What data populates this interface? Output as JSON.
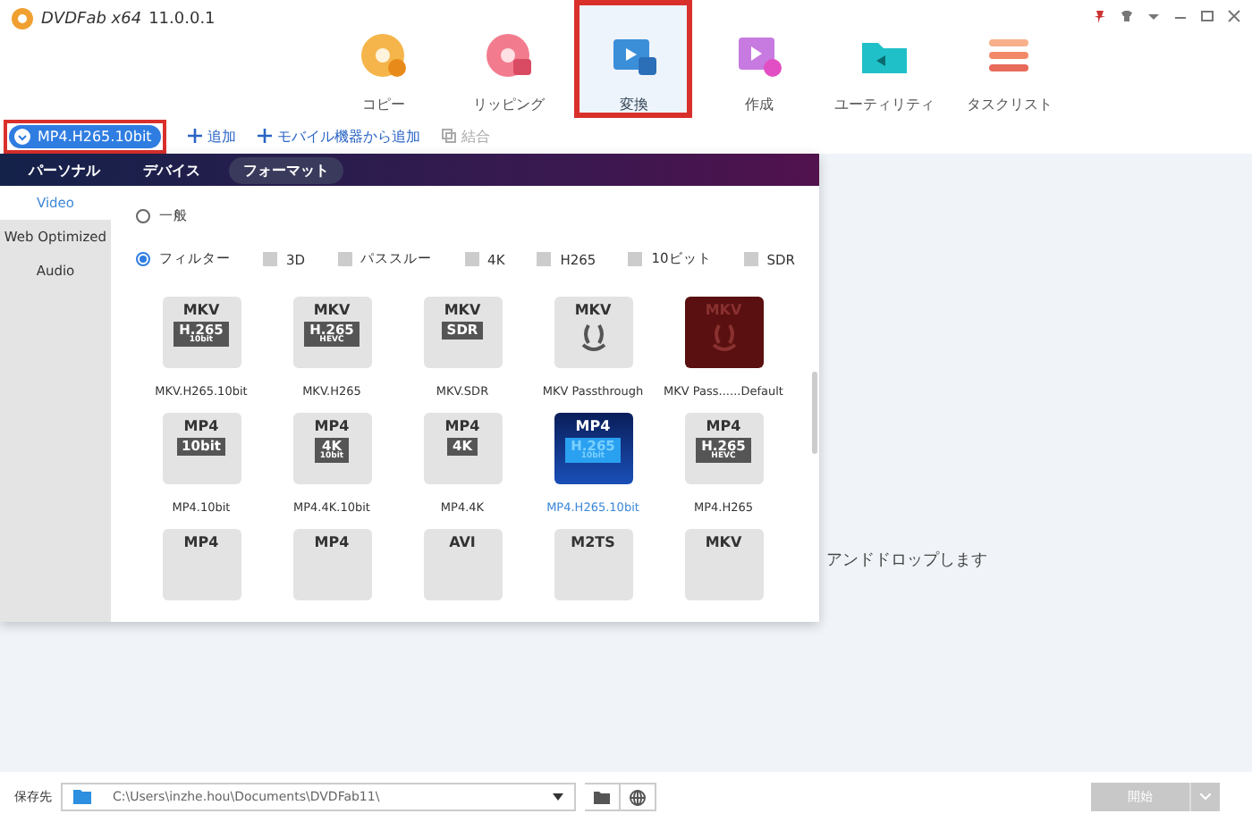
{
  "window": {
    "app_name": "DVDFab x64",
    "version": "11.0.0.1"
  },
  "nav": [
    {
      "label": "コピー",
      "kind": "copy",
      "selected": false
    },
    {
      "label": "リッピング",
      "kind": "ripping",
      "selected": false
    },
    {
      "label": "変換",
      "kind": "convert",
      "selected": true
    },
    {
      "label": "作成",
      "kind": "creator",
      "selected": false
    },
    {
      "label": "ユーティリティ",
      "kind": "utility",
      "selected": false
    },
    {
      "label": "タスクリスト",
      "kind": "tasks",
      "selected": false
    }
  ],
  "toolbar": {
    "profile": "MP4.H265.10bit",
    "add": "追加",
    "add_mobile": "モバイル機器から追加",
    "merge": {
      "label": "結合",
      "disabled": true
    }
  },
  "panel": {
    "tabs": [
      {
        "label": "パーソナル",
        "selected": false
      },
      {
        "label": "デバイス",
        "selected": false
      },
      {
        "label": "フォーマット",
        "selected": true
      }
    ],
    "categories": [
      {
        "label": "Video",
        "selected": true
      },
      {
        "label": "Web Optimized",
        "selected": false
      },
      {
        "label": "Audio",
        "selected": false
      }
    ],
    "modes": [
      {
        "label": "一般",
        "selected": false
      },
      {
        "label": "フィルター",
        "selected": true
      }
    ],
    "filters": [
      {
        "label": "3D",
        "checked": false
      },
      {
        "label": "パススルー",
        "checked": false
      },
      {
        "label": "4K",
        "checked": false
      },
      {
        "label": "H265",
        "checked": false
      },
      {
        "label": "10ビット",
        "checked": false
      },
      {
        "label": "SDR",
        "checked": false
      }
    ],
    "profiles": [
      {
        "format": "MKV",
        "kind": "badge",
        "badge": [
          "H.265",
          "10bit"
        ],
        "label": "MKV.H265.10bit",
        "selected": false
      },
      {
        "format": "MKV",
        "kind": "badge",
        "badge": [
          "H.265",
          "HEVC"
        ],
        "label": "MKV.H265",
        "selected": false
      },
      {
        "format": "MKV",
        "kind": "badge",
        "badge": [
          "SDR"
        ],
        "label": "MKV.SDR",
        "selected": false
      },
      {
        "format": "MKV",
        "kind": "passthrough",
        "label": "MKV Passthrough",
        "selected": false
      },
      {
        "format": "MKV",
        "kind": "passthrough-default",
        "label": "MKV Pass......Default",
        "selected": false
      },
      {
        "format": "MP4",
        "kind": "badge",
        "badge": [
          "10bit"
        ],
        "label": "MP4.10bit",
        "selected": false
      },
      {
        "format": "MP4",
        "kind": "badge",
        "badge": [
          "4K",
          "10bit"
        ],
        "label": "MP4.4K.10bit",
        "selected": false
      },
      {
        "format": "MP4",
        "kind": "badge",
        "badge": [
          "4K"
        ],
        "label": "MP4.4K",
        "selected": false
      },
      {
        "format": "MP4",
        "kind": "badge",
        "badge": [
          "H.265",
          "10bit"
        ],
        "label": "MP4.H265.10bit",
        "selected": true
      },
      {
        "format": "MP4",
        "kind": "badge",
        "badge": [
          "H.265",
          "HEVC"
        ],
        "label": "MP4.H265",
        "selected": false
      },
      {
        "format": "MP4",
        "kind": "partial",
        "selected": false
      },
      {
        "format": "MP4",
        "kind": "partial",
        "selected": false
      },
      {
        "format": "AVI",
        "kind": "partial",
        "selected": false
      },
      {
        "format": "M2TS",
        "kind": "partial",
        "selected": false
      },
      {
        "format": "MKV",
        "kind": "partial",
        "selected": false
      }
    ]
  },
  "drop_hint": "アンドドロップします",
  "footer": {
    "save_label": "保存先",
    "path": "C:\\Users\\inzhe.hou\\Documents\\DVDFab11\\",
    "start": {
      "label": "開始",
      "disabled": true
    }
  }
}
